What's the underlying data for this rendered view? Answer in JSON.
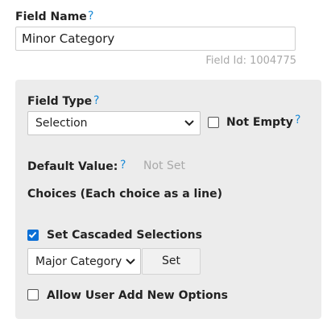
{
  "field_name": {
    "label": "Field Name",
    "help": "?",
    "value": "Minor Category",
    "field_id_text": "Field Id: 1004775"
  },
  "field_type": {
    "label": "Field Type",
    "help": "?",
    "selected": "Selection",
    "not_empty_label": "Not Empty",
    "not_empty_help": "?",
    "not_empty_checked": false
  },
  "default_value": {
    "label": "Default Value:",
    "help": "?",
    "value": "Not Set"
  },
  "choices_label": "Choices (Each choice as a line)",
  "cascade": {
    "checkbox_label": "Set Cascaded Selections",
    "checked": true,
    "source_selected": "Major Category",
    "set_button_label": "Set"
  },
  "allow_new": {
    "label": "Allow User Add New Options",
    "checked": false
  },
  "colors": {
    "help_blue": "#1b8ad6",
    "checkbox_blue": "#0b6fd6",
    "panel_bg": "#ececec"
  },
  "icons": [
    "help-icon",
    "chevron-down-icon",
    "checkmark-icon"
  ]
}
